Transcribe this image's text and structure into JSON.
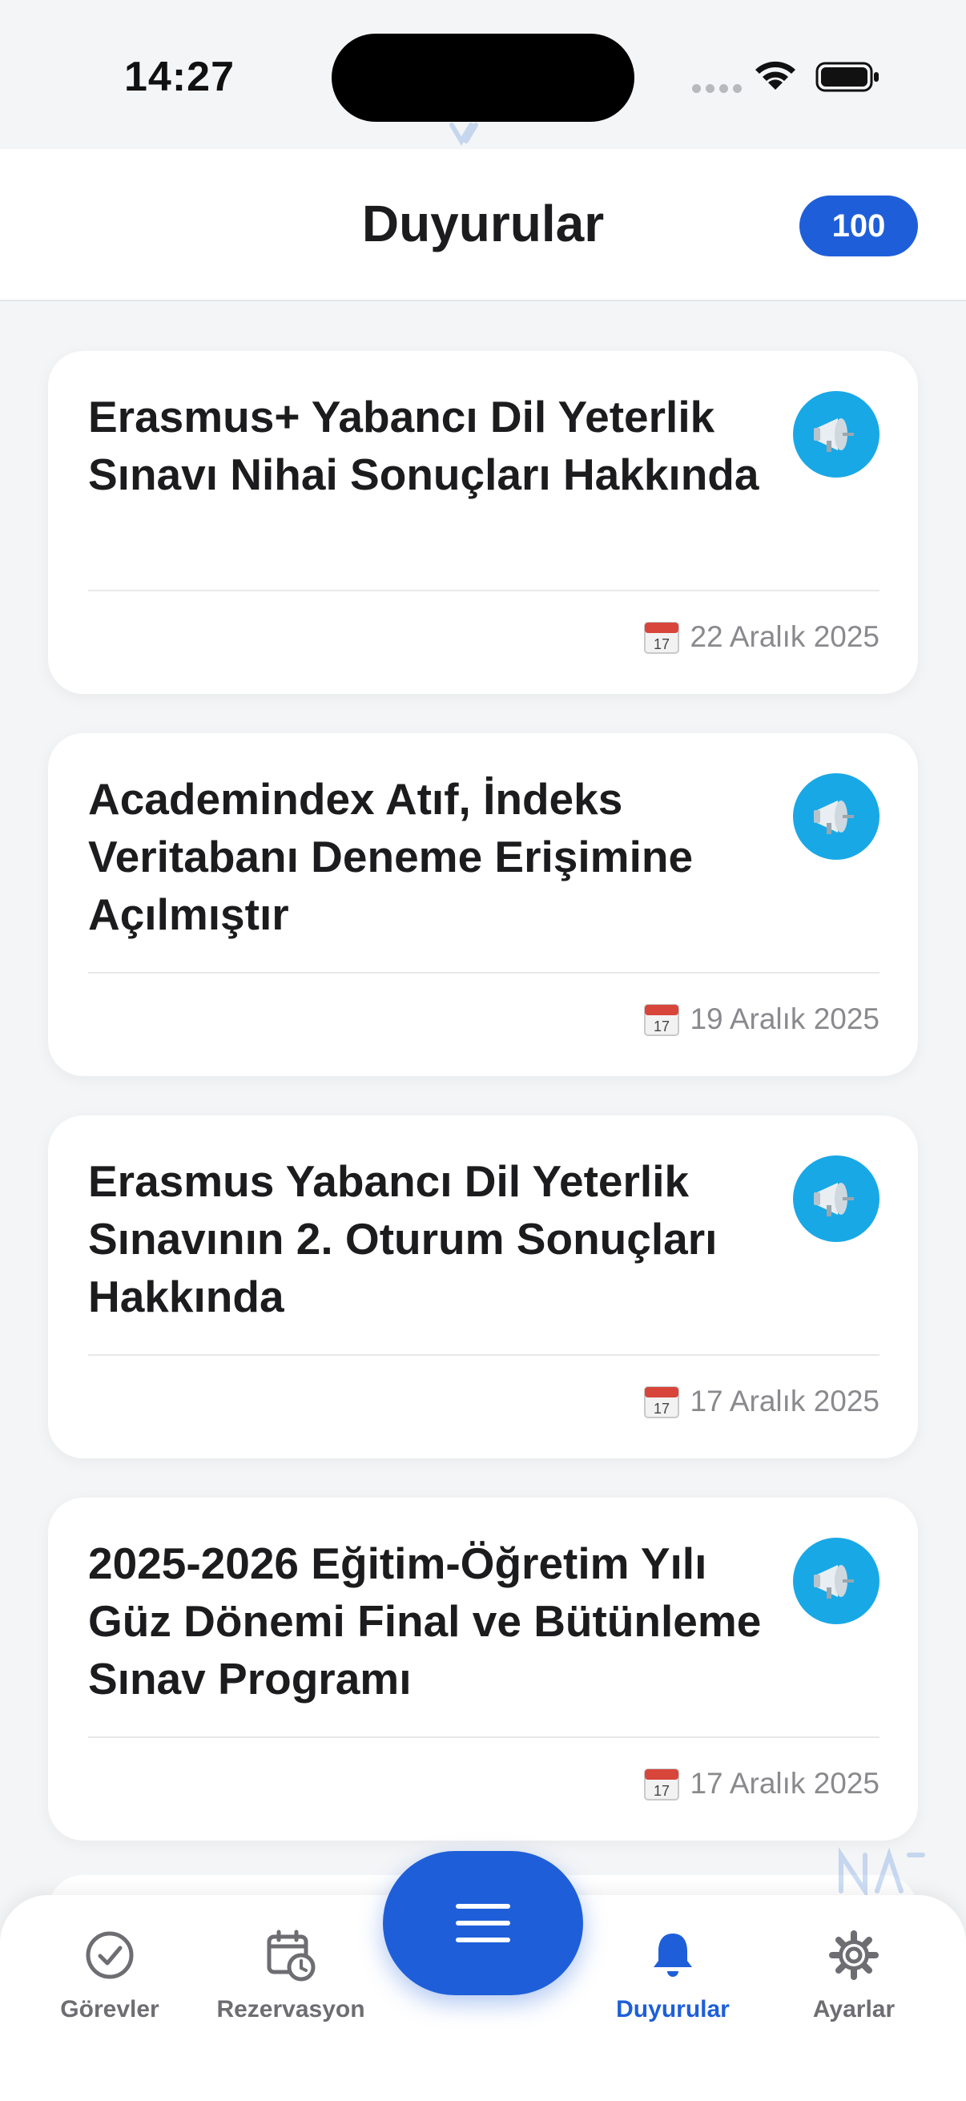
{
  "status_bar": {
    "time": "14:27"
  },
  "header": {
    "title": "Duyurular",
    "count": "100"
  },
  "announcements": [
    {
      "title": "Erasmus+ Yabancı Dil Yeterlik Sınavı Nihai Sonuçları Hakkında",
      "date": "22 Aralık 2025"
    },
    {
      "title": "Academindex Atıf, İndeks Veritabanı Deneme Erişimine Açılmıştır",
      "date": "19 Aralık 2025"
    },
    {
      "title": "Erasmus Yabancı Dil Yeterlik Sınavının 2. Oturum Sonuçları Hakkında",
      "date": "17 Aralık 2025"
    },
    {
      "title": "2025-2026 Eğitim-Öğretim Yılı Güz Dönemi Final ve Bütünleme Sınav Programı",
      "date": "17 Aralık 2025"
    }
  ],
  "tab_bar": {
    "tabs": [
      {
        "label": "Görevler",
        "icon": "check-circle-icon"
      },
      {
        "label": "Rezervasyon",
        "icon": "calendar-clock-icon"
      },
      {
        "label": "Duyurular",
        "icon": "bell-icon",
        "active": true
      },
      {
        "label": "Ayarlar",
        "icon": "gear-icon"
      }
    ],
    "center_button_icon": "menu-icon"
  },
  "colors": {
    "accent": "#1e5fd9",
    "announcement_icon_bg": "#19a8e6",
    "background": "#f4f5f7"
  }
}
